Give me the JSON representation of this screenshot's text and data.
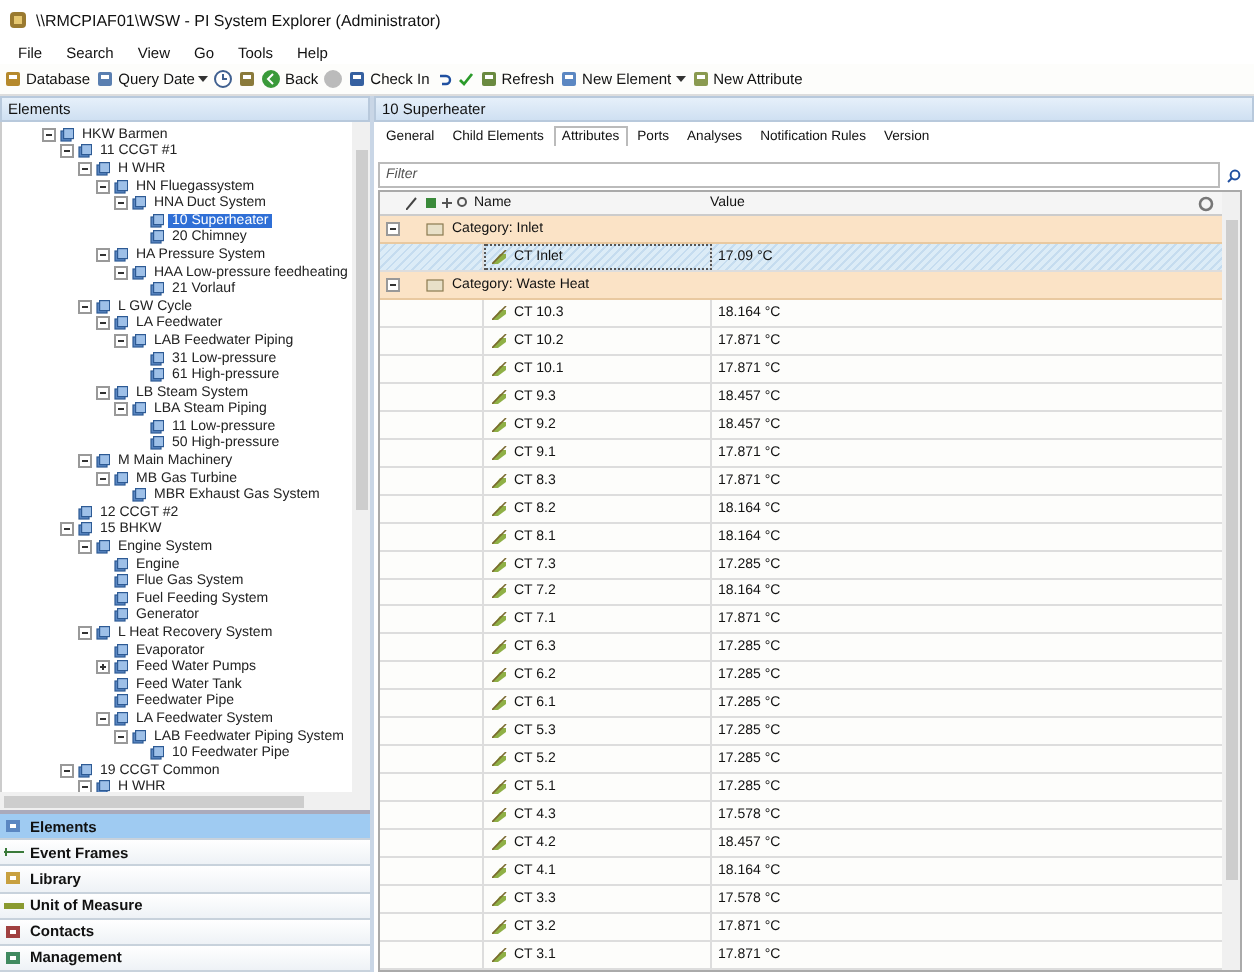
{
  "window": {
    "title": "\\\\RMCPIAF01\\WSW - PI System Explorer (Administrator)"
  },
  "menu": [
    "File",
    "Search",
    "View",
    "Go",
    "Tools",
    "Help"
  ],
  "toolbar": [
    {
      "kind": "button",
      "label": "Database"
    },
    {
      "kind": "button",
      "label": "Query Date",
      "dropdown": true
    },
    {
      "kind": "icon"
    },
    {
      "kind": "icon"
    },
    {
      "kind": "button",
      "label": "Back"
    },
    {
      "kind": "icon"
    },
    {
      "kind": "button",
      "label": "Check In"
    },
    {
      "kind": "icon"
    },
    {
      "kind": "icon"
    },
    {
      "kind": "button",
      "label": "Refresh"
    },
    {
      "kind": "button",
      "label": "New Element",
      "dropdown": true
    },
    {
      "kind": "button",
      "label": "New Attribute"
    }
  ],
  "left_panel": {
    "title": "Elements",
    "tree": [
      {
        "label": "HKW Barmen",
        "expanded": true,
        "selected": false,
        "children": [
          {
            "label": "11 CCGT #1",
            "expanded": true,
            "selected": false,
            "children": [
              {
                "label": "H WHR",
                "expanded": true,
                "selected": false,
                "children": [
                  {
                    "label": "HN Fluegassystem",
                    "expanded": true,
                    "selected": false,
                    "children": [
                      {
                        "label": "HNA Duct System",
                        "expanded": true,
                        "selected": false,
                        "children": [
                          {
                            "label": "10 Superheater",
                            "selected": true
                          },
                          {
                            "label": "20 Chimney",
                            "selected": false
                          }
                        ]
                      }
                    ]
                  },
                  {
                    "label": "HA Pressure System",
                    "expanded": true,
                    "selected": false,
                    "children": [
                      {
                        "label": "HAA Low-pressure feedheating",
                        "expanded": true,
                        "selected": false,
                        "children": [
                          {
                            "label": "21 Vorlauf",
                            "selected": false
                          }
                        ]
                      }
                    ]
                  }
                ]
              },
              {
                "label": "L GW Cycle",
                "expanded": true,
                "selected": false,
                "children": [
                  {
                    "label": "LA Feedwater",
                    "expanded": true,
                    "selected": false,
                    "children": [
                      {
                        "label": "LAB Feedwater Piping",
                        "expanded": true,
                        "selected": false,
                        "children": [
                          {
                            "label": "31 Low-pressure",
                            "selected": false
                          },
                          {
                            "label": "61 High-pressure",
                            "selected": false
                          }
                        ]
                      }
                    ]
                  },
                  {
                    "label": "LB Steam System",
                    "expanded": true,
                    "selected": false,
                    "children": [
                      {
                        "label": "LBA Steam Piping",
                        "expanded": true,
                        "selected": false,
                        "children": [
                          {
                            "label": "11 Low-pressure",
                            "selected": false
                          },
                          {
                            "label": "50 High-pressure",
                            "selected": false
                          }
                        ]
                      }
                    ]
                  }
                ]
              },
              {
                "label": "M Main Machinery",
                "expanded": true,
                "selected": false,
                "children": [
                  {
                    "label": "MB Gas Turbine",
                    "expanded": true,
                    "selected": false,
                    "children": [
                      {
                        "label": "MBR Exhaust Gas System",
                        "selected": false
                      }
                    ]
                  }
                ]
              }
            ]
          },
          {
            "label": "12 CCGT #2",
            "selected": false
          },
          {
            "label": "15 BHKW",
            "expanded": true,
            "selected": false,
            "children": [
              {
                "label": "Engine System",
                "expanded": true,
                "selected": false,
                "children": [
                  {
                    "label": "Engine",
                    "selected": false
                  },
                  {
                    "label": "Flue Gas System",
                    "selected": false
                  },
                  {
                    "label": "Fuel Feeding System",
                    "selected": false
                  },
                  {
                    "label": "Generator",
                    "selected": false
                  }
                ]
              },
              {
                "label": "L Heat Recovery System",
                "expanded": true,
                "selected": false,
                "children": [
                  {
                    "label": "Evaporator",
                    "selected": false
                  },
                  {
                    "label": "Feed Water Pumps",
                    "expanded": false,
                    "selected": false
                  },
                  {
                    "label": "Feed Water Tank",
                    "selected": false
                  },
                  {
                    "label": "Feedwater Pipe",
                    "selected": false
                  },
                  {
                    "label": "LA Feedwater System",
                    "expanded": true,
                    "selected": false,
                    "children": [
                      {
                        "label": "LAB Feedwater Piping System",
                        "expanded": true,
                        "selected": false,
                        "children": [
                          {
                            "label": "10 Feedwater Pipe",
                            "selected": false
                          }
                        ]
                      }
                    ]
                  }
                ]
              }
            ]
          },
          {
            "label": "19 CCGT Common",
            "expanded": true,
            "selected": false,
            "children": [
              {
                "label": "H WHR",
                "expanded": true,
                "selected": false
              }
            ]
          }
        ]
      }
    ]
  },
  "nav": [
    {
      "label": "Elements",
      "selected": true
    },
    {
      "label": "Event Frames",
      "selected": false
    },
    {
      "label": "Library",
      "selected": false
    },
    {
      "label": "Unit of Measure",
      "selected": false
    },
    {
      "label": "Contacts",
      "selected": false
    },
    {
      "label": "Management",
      "selected": false
    }
  ],
  "right_panel": {
    "title": "10 Superheater",
    "tabs": [
      {
        "label": "General",
        "selected": false
      },
      {
        "label": "Child Elements",
        "selected": false
      },
      {
        "label": "Attributes",
        "selected": true
      },
      {
        "label": "Ports",
        "selected": false
      },
      {
        "label": "Analyses",
        "selected": false
      },
      {
        "label": "Notification Rules",
        "selected": false
      },
      {
        "label": "Version",
        "selected": false
      }
    ],
    "filter": {
      "placeholder": "Filter"
    },
    "columns": [
      "Name",
      "Value"
    ],
    "rows": [
      {
        "kind": "category",
        "label": "Category: Inlet",
        "expanded": true
      },
      {
        "kind": "attribute",
        "name": "CT Inlet",
        "value": "17.09 °C",
        "selected": true
      },
      {
        "kind": "category",
        "label": "Category: Waste Heat",
        "expanded": true
      },
      {
        "kind": "attribute",
        "name": "CT 10.3",
        "value": "18.164 °C",
        "selected": false
      },
      {
        "kind": "attribute",
        "name": "CT 10.2",
        "value": "17.871 °C",
        "selected": false
      },
      {
        "kind": "attribute",
        "name": "CT 10.1",
        "value": "17.871 °C",
        "selected": false
      },
      {
        "kind": "attribute",
        "name": "CT 9.3",
        "value": "18.457 °C",
        "selected": false
      },
      {
        "kind": "attribute",
        "name": "CT 9.2",
        "value": "18.457 °C",
        "selected": false
      },
      {
        "kind": "attribute",
        "name": "CT 9.1",
        "value": "17.871 °C",
        "selected": false
      },
      {
        "kind": "attribute",
        "name": "CT 8.3",
        "value": "17.871 °C",
        "selected": false
      },
      {
        "kind": "attribute",
        "name": "CT 8.2",
        "value": "18.164 °C",
        "selected": false
      },
      {
        "kind": "attribute",
        "name": "CT 8.1",
        "value": "18.164 °C",
        "selected": false
      },
      {
        "kind": "attribute",
        "name": "CT 7.3",
        "value": "17.285 °C",
        "selected": false
      },
      {
        "kind": "attribute",
        "name": "CT 7.2",
        "value": "18.164 °C",
        "selected": false
      },
      {
        "kind": "attribute",
        "name": "CT 7.1",
        "value": "17.871 °C",
        "selected": false
      },
      {
        "kind": "attribute",
        "name": "CT 6.3",
        "value": "17.285 °C",
        "selected": false
      },
      {
        "kind": "attribute",
        "name": "CT 6.2",
        "value": "17.285 °C",
        "selected": false
      },
      {
        "kind": "attribute",
        "name": "CT 6.1",
        "value": "17.285 °C",
        "selected": false
      },
      {
        "kind": "attribute",
        "name": "CT 5.3",
        "value": "17.285 °C",
        "selected": false
      },
      {
        "kind": "attribute",
        "name": "CT 5.2",
        "value": "17.285 °C",
        "selected": false
      },
      {
        "kind": "attribute",
        "name": "CT 5.1",
        "value": "17.285 °C",
        "selected": false
      },
      {
        "kind": "attribute",
        "name": "CT 4.3",
        "value": "17.578 °C",
        "selected": false
      },
      {
        "kind": "attribute",
        "name": "CT 4.2",
        "value": "18.457 °C",
        "selected": false
      },
      {
        "kind": "attribute",
        "name": "CT 4.1",
        "value": "18.164 °C",
        "selected": false
      },
      {
        "kind": "attribute",
        "name": "CT 3.3",
        "value": "17.578 °C",
        "selected": false
      },
      {
        "kind": "attribute",
        "name": "CT 3.2",
        "value": "17.871 °C",
        "selected": false
      },
      {
        "kind": "attribute",
        "name": "CT 3.1",
        "value": "17.871 °C",
        "selected": false
      }
    ]
  }
}
